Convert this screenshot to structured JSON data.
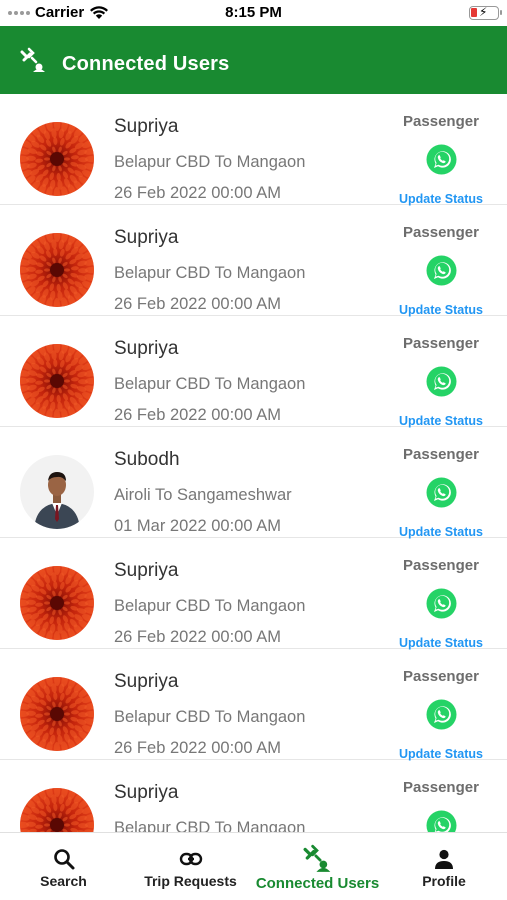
{
  "status_bar": {
    "carrier": "Carrier",
    "time": "8:15 PM",
    "battery_color": "#e53935"
  },
  "header": {
    "title": "Connected Users",
    "icon": "connected-users-icon",
    "background": "#198a31"
  },
  "colors": {
    "accent": "#198a31",
    "link": "#2196f3",
    "whatsapp": "#25d366"
  },
  "users": [
    {
      "name": "Supriya",
      "route": "Belapur CBD To Mangaon",
      "date": "26 Feb 2022 00:00 AM",
      "role": "Passenger",
      "action": "Update Status",
      "avatar": "flower"
    },
    {
      "name": "Supriya",
      "route": "Belapur CBD To Mangaon",
      "date": "26 Feb 2022 00:00 AM",
      "role": "Passenger",
      "action": "Update Status",
      "avatar": "flower"
    },
    {
      "name": "Supriya",
      "route": "Belapur CBD To Mangaon",
      "date": "26 Feb 2022 00:00 AM",
      "role": "Passenger",
      "action": "Update Status",
      "avatar": "flower"
    },
    {
      "name": "Subodh",
      "route": "Airoli To Sangameshwar",
      "date": "01 Mar 2022 00:00 AM",
      "role": "Passenger",
      "action": "Update Status",
      "avatar": "person"
    },
    {
      "name": "Supriya",
      "route": "Belapur CBD To Mangaon",
      "date": "26 Feb 2022 00:00 AM",
      "role": "Passenger",
      "action": "Update Status",
      "avatar": "flower"
    },
    {
      "name": "Supriya",
      "route": "Belapur CBD To Mangaon",
      "date": "26 Feb 2022 00:00 AM",
      "role": "Passenger",
      "action": "Update Status",
      "avatar": "flower"
    },
    {
      "name": "Supriya",
      "route": "Belapur CBD To Mangaon",
      "date": "",
      "role": "Passenger",
      "action": "",
      "avatar": "flower"
    }
  ],
  "bottom_nav": [
    {
      "label": "Search",
      "icon": "search-icon",
      "active": false
    },
    {
      "label": "Trip Requests",
      "icon": "link-icon",
      "active": false
    },
    {
      "label": "Connected Users",
      "icon": "connected-users-icon",
      "active": true
    },
    {
      "label": "Profile",
      "icon": "person-icon",
      "active": false
    }
  ]
}
